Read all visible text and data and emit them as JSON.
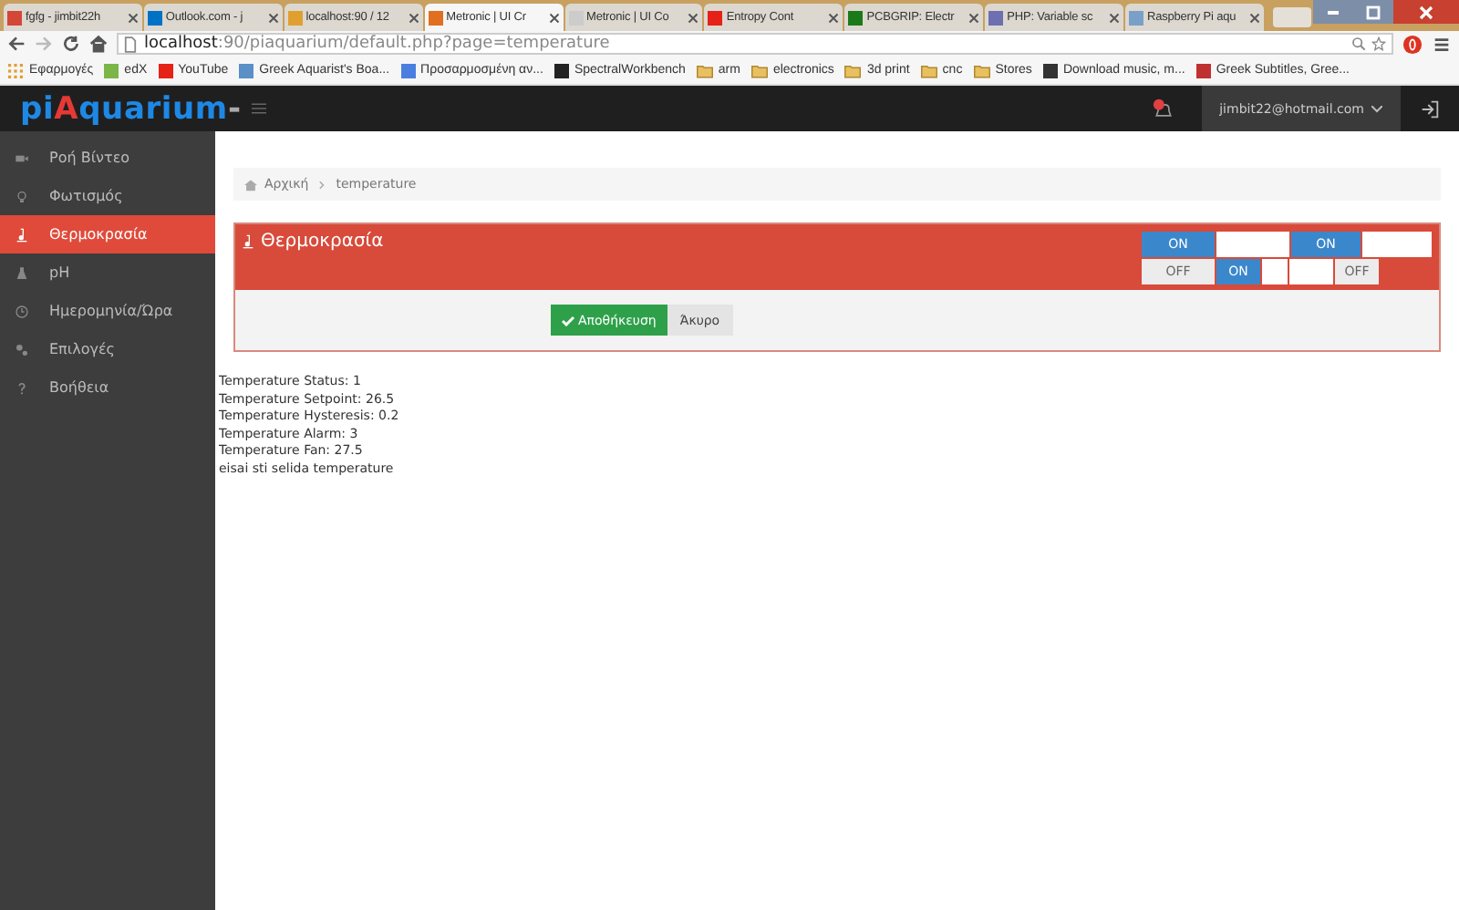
{
  "browser": {
    "tabs": [
      {
        "title": "fgfg - jimbit22h",
        "color": "#d44638",
        "selected": false
      },
      {
        "title": "Outlook.com - j",
        "color": "#0072c6",
        "selected": false
      },
      {
        "title": "localhost:90 / 12",
        "color": "#e0a030",
        "selected": false
      },
      {
        "title": "Metronic | UI Cr",
        "color": "#e07020",
        "selected": true
      },
      {
        "title": "Metronic | UI Co",
        "color": "#cccccc",
        "selected": false
      },
      {
        "title": "Entropy Cont",
        "color": "#e62117",
        "selected": false
      },
      {
        "title": "PCBGRIP: Electr",
        "color": "#1a7a1a",
        "selected": false
      },
      {
        "title": "PHP: Variable sc",
        "color": "#6d6fb0",
        "selected": false
      },
      {
        "title": "Raspberry Pi aqu",
        "color": "#7aa0c8",
        "selected": false
      }
    ],
    "address": {
      "host": "localhost",
      "rest": ":90/piaquarium/default.php?page=temperature"
    },
    "bookmarks": [
      {
        "label": "Εφαρμογές",
        "kind": "apps",
        "color": "#e0a030"
      },
      {
        "label": "edX",
        "kind": "site",
        "color": "#7ab648"
      },
      {
        "label": "YouTube",
        "kind": "site",
        "color": "#e62117"
      },
      {
        "label": "Greek Aquarist's Boa...",
        "kind": "site",
        "color": "#5a8fc8"
      },
      {
        "label": "Προσαρμοσμένη αν...",
        "kind": "site",
        "color": "#4a7fe0"
      },
      {
        "label": "SpectralWorkbench",
        "kind": "site",
        "color": "#222222"
      },
      {
        "label": "arm",
        "kind": "folder",
        "color": "#e8c060"
      },
      {
        "label": "electronics",
        "kind": "folder",
        "color": "#e8c060"
      },
      {
        "label": "3d print",
        "kind": "folder",
        "color": "#e8c060"
      },
      {
        "label": "cnc",
        "kind": "folder",
        "color": "#e8c060"
      },
      {
        "label": "Stores",
        "kind": "folder",
        "color": "#e8c060"
      },
      {
        "label": "Download music, m...",
        "kind": "site",
        "color": "#333333"
      },
      {
        "label": "Greek Subtitles, Gree...",
        "kind": "site",
        "color": "#c03030"
      }
    ]
  },
  "header": {
    "logo": [
      {
        "text": "pi",
        "color": "#1e88e5"
      },
      {
        "text": "A",
        "color": "#e53935"
      },
      {
        "text": "quarium",
        "color": "#1e88e5"
      },
      {
        "text": "-",
        "color": "#aaaaaa"
      }
    ],
    "user": "jimbit22@hotmail.com"
  },
  "sidebar": {
    "items": [
      {
        "label": "Ροή Βίντεο",
        "selected": false
      },
      {
        "label": "Φωτισμός",
        "selected": false
      },
      {
        "label": "Θερμοκρασία",
        "selected": true
      },
      {
        "label": "pH",
        "selected": false
      },
      {
        "label": "Ημερομηνία/Ώρα",
        "selected": false
      },
      {
        "label": "Επιλογές",
        "selected": false
      },
      {
        "label": "Βοήθεια",
        "selected": false
      }
    ]
  },
  "breadcrumb": [
    "Αρχική",
    "temperature"
  ],
  "panel": {
    "title": "Θερμοκρασία",
    "switch_rows": [
      [
        {
          "kind": "on",
          "label": "ON"
        },
        {
          "kind": "gap"
        },
        {
          "kind": "on",
          "label": "ON"
        },
        {
          "kind": "gap"
        }
      ],
      [
        {
          "kind": "off",
          "label": "OFF"
        },
        {
          "kind": "on",
          "label": "ON"
        },
        {
          "kind": "gap"
        },
        {
          "kind": "gap"
        },
        {
          "kind": "off",
          "label": "OFF"
        }
      ]
    ],
    "save": "Αποθήκευση",
    "cancel": "Άκυρο"
  },
  "debug_lines": [
    "Temperature Status: 1",
    "Temperature Setpoint: 26.5",
    "Temperature Hysteresis: 0.2",
    "Temperature Alarm: 3",
    "Temperature Fan: 27.5",
    "eisai sti selida temperature"
  ]
}
